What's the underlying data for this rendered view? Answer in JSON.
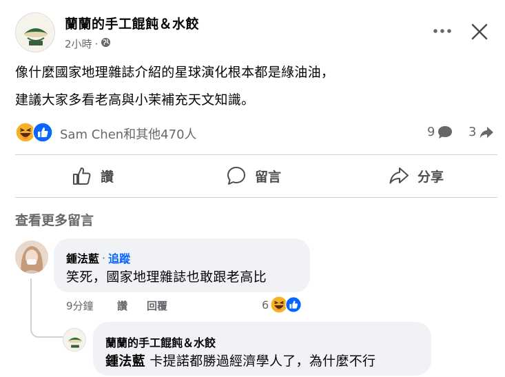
{
  "post": {
    "page_name": "蘭蘭的手工餛飩＆水餃",
    "time": "2小時",
    "dot": "·",
    "lines": [
      "像什麼國家地理雜誌介紹的星球演化根本都是綠油油，",
      "建議大家多看老高與小茉補充天文知識。"
    ],
    "reactions_text": "Sam Chen和其他470人",
    "comments_count": "9",
    "shares_count": "3"
  },
  "actions": {
    "like": "讚",
    "comment": "留言",
    "share": "分享"
  },
  "view_more": "查看更多留言",
  "comment": {
    "author": "鍾法藍",
    "dot": "·",
    "follow": "追蹤",
    "text": "笑死，國家地理雜誌也敢跟老高比",
    "time": "9分鐘",
    "like": "讚",
    "reply": "回覆",
    "reaction_count": "6"
  },
  "reply": {
    "author": "蘭蘭的手工餛飩＆水餃",
    "tag": "鍾法藍",
    "text": " 卡提諾都勝過經濟學人了，為什麼不行"
  },
  "colors": {
    "accent": "#0866ff",
    "muted": "#65676b",
    "bubble": "#f0f2f5",
    "haha": "#f7b125"
  }
}
